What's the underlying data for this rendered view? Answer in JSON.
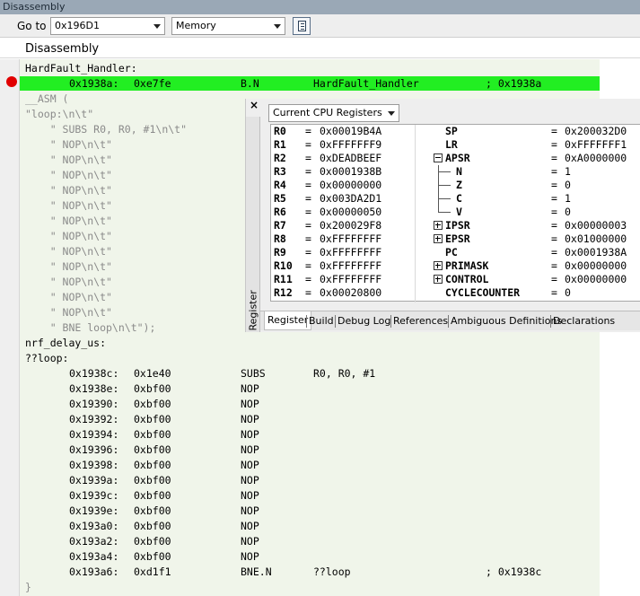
{
  "window": {
    "title": "Disassembly"
  },
  "toolbar": {
    "goto_label": "Go to",
    "goto_value": "0x196D1",
    "view_value": "Memory",
    "doc_icon": "document-icon"
  },
  "pane": {
    "header": "Disassembly"
  },
  "code_lines": [
    {
      "t": "HardFault_Handler:",
      "style": "label"
    },
    {
      "addr": "0x1938a:",
      "op": "0xe7fe",
      "mn": "B.N",
      "args": "HardFault_Handler",
      "comment": "; 0x1938a",
      "current": true,
      "breakpoint": true
    },
    {
      "t": "__ASM (",
      "style": "src"
    },
    {
      "t": "\"loop:\\n\\t\"",
      "style": "src"
    },
    {
      "t": "    \" SUBS R0, R0, #1\\n\\t\"",
      "style": "src"
    },
    {
      "t": "    \" NOP\\n\\t\"",
      "style": "src"
    },
    {
      "t": "    \" NOP\\n\\t\"",
      "style": "src"
    },
    {
      "t": "    \" NOP\\n\\t\"",
      "style": "src"
    },
    {
      "t": "    \" NOP\\n\\t\"",
      "style": "src"
    },
    {
      "t": "    \" NOP\\n\\t\"",
      "style": "src"
    },
    {
      "t": "    \" NOP\\n\\t\"",
      "style": "src"
    },
    {
      "t": "    \" NOP\\n\\t\"",
      "style": "src"
    },
    {
      "t": "    \" NOP\\n\\t\"",
      "style": "src"
    },
    {
      "t": "    \" NOP\\n\\t\"",
      "style": "src"
    },
    {
      "t": "    \" NOP\\n\\t\"",
      "style": "src"
    },
    {
      "t": "    \" NOP\\n\\t\"",
      "style": "src"
    },
    {
      "t": "    \" NOP\\n\\t\"",
      "style": "src"
    },
    {
      "t": "    \" BNE loop\\n\\t\");",
      "style": "src"
    },
    {
      "t": "nrf_delay_us:",
      "style": "label"
    },
    {
      "t": "??loop:",
      "style": "label"
    },
    {
      "addr": "0x1938c:",
      "op": "0x1e40",
      "mn": "SUBS",
      "args": "R0, R0, #1",
      "comment": ""
    },
    {
      "addr": "0x1938e:",
      "op": "0xbf00",
      "mn": "NOP",
      "args": "",
      "comment": ""
    },
    {
      "addr": "0x19390:",
      "op": "0xbf00",
      "mn": "NOP",
      "args": "",
      "comment": ""
    },
    {
      "addr": "0x19392:",
      "op": "0xbf00",
      "mn": "NOP",
      "args": "",
      "comment": ""
    },
    {
      "addr": "0x19394:",
      "op": "0xbf00",
      "mn": "NOP",
      "args": "",
      "comment": ""
    },
    {
      "addr": "0x19396:",
      "op": "0xbf00",
      "mn": "NOP",
      "args": "",
      "comment": ""
    },
    {
      "addr": "0x19398:",
      "op": "0xbf00",
      "mn": "NOP",
      "args": "",
      "comment": ""
    },
    {
      "addr": "0x1939a:",
      "op": "0xbf00",
      "mn": "NOP",
      "args": "",
      "comment": ""
    },
    {
      "addr": "0x1939c:",
      "op": "0xbf00",
      "mn": "NOP",
      "args": "",
      "comment": ""
    },
    {
      "addr": "0x1939e:",
      "op": "0xbf00",
      "mn": "NOP",
      "args": "",
      "comment": ""
    },
    {
      "addr": "0x193a0:",
      "op": "0xbf00",
      "mn": "NOP",
      "args": "",
      "comment": ""
    },
    {
      "addr": "0x193a2:",
      "op": "0xbf00",
      "mn": "NOP",
      "args": "",
      "comment": ""
    },
    {
      "addr": "0x193a4:",
      "op": "0xbf00",
      "mn": "NOP",
      "args": "",
      "comment": ""
    },
    {
      "addr": "0x193a6:",
      "op": "0xd1f1",
      "mn": "BNE.N",
      "args": "??loop",
      "comment": "; 0x1938c"
    },
    {
      "t": "}",
      "style": "src"
    }
  ],
  "registers": {
    "close_label": "×",
    "view_select": "Current CPU Registers",
    "vertical_tab": "Register",
    "rows": [
      {
        "l": "R0",
        "lv": "0x00019B4A",
        "r": "SP",
        "rv": "0x200032D0"
      },
      {
        "l": "R1",
        "lv": "0xFFFFFFF9",
        "r": "LR",
        "rv": "0xFFFFFFF1"
      },
      {
        "l": "R2",
        "lv": "0xDEADBEEF",
        "r": "APSR",
        "rv": "0xA0000000",
        "tree": "open"
      },
      {
        "l": "R3",
        "lv": "0x0001938B",
        "r": "N",
        "rv": "1",
        "child": true
      },
      {
        "l": "R4",
        "lv": "0x00000000",
        "r": "Z",
        "rv": "0",
        "child": true
      },
      {
        "l": "R5",
        "lv": "0x003DA2D1",
        "r": "C",
        "rv": "1",
        "child": true
      },
      {
        "l": "R6",
        "lv": "0x00000050",
        "r": "V",
        "rv": "0",
        "child": true,
        "last": true
      },
      {
        "l": "R7",
        "lv": "0x200029F8",
        "r": "IPSR",
        "rv": "0x00000003",
        "tree": "closed"
      },
      {
        "l": "R8",
        "lv": "0xFFFFFFFF",
        "r": "EPSR",
        "rv": "0x01000000",
        "tree": "closed"
      },
      {
        "l": "R9",
        "lv": "0xFFFFFFFF",
        "r": "PC",
        "rv": "0x0001938A"
      },
      {
        "l": "R10",
        "lv": "0xFFFFFFFF",
        "r": "PRIMASK",
        "rv": "0x00000000",
        "tree": "closed"
      },
      {
        "l": "R11",
        "lv": "0xFFFFFFFF",
        "r": "CONTROL",
        "rv": "0x00000000",
        "tree": "closed"
      },
      {
        "l": "R12",
        "lv": "0x00020800",
        "r": "CYCLECOUNTER",
        "rv": "0"
      }
    ],
    "tabs": [
      "Register",
      "Build",
      "Debug Log",
      "References",
      "Ambiguous Definitions",
      "Declarations"
    ],
    "active_tab": "Register"
  },
  "colors": {
    "current_line": "#22ee22",
    "code_background": "#f0f5ea",
    "breakpoint": "#e10000",
    "source_text": "#8a8a8a"
  }
}
